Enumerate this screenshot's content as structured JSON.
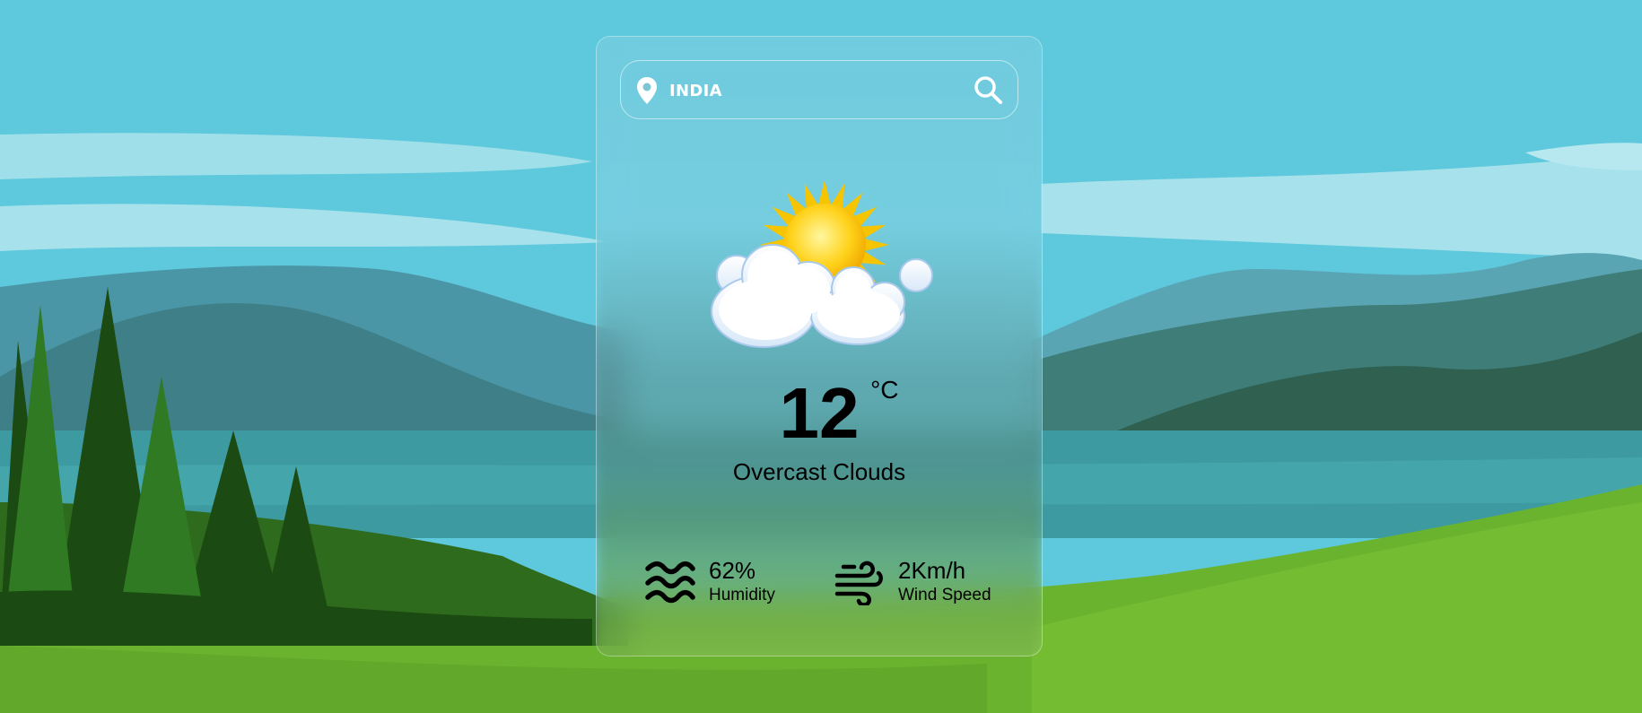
{
  "search": {
    "value": "INDIA",
    "location_icon": "location-pin-icon",
    "search_icon": "magnifier-icon"
  },
  "weather": {
    "icon": "partly-cloudy-sun-icon",
    "temperature": "12",
    "unit": "°C",
    "description": "Overcast Clouds"
  },
  "stats": {
    "humidity": {
      "icon": "humidity-waves-icon",
      "value": "62%",
      "label": "Humidity"
    },
    "wind": {
      "icon": "wind-icon",
      "value": "2Km/h",
      "label": "Wind Speed"
    }
  },
  "colors": {
    "sky": "#5ec8dc",
    "grass": "#6ab32e",
    "forest_dark": "#1b4a12",
    "card_text": "#000000",
    "search_text": "#ffffff"
  }
}
